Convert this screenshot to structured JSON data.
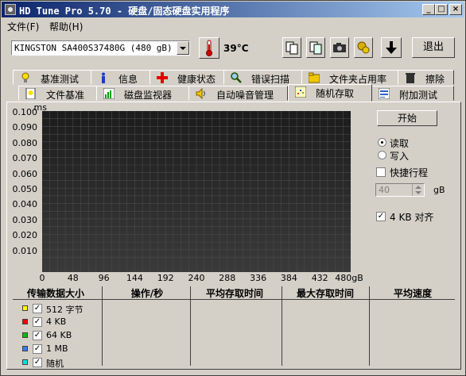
{
  "window": {
    "title": "HD Tune Pro 5.70 - 硬盘/固态硬盘实用程序",
    "controls": {
      "minimize": "_",
      "maximize": "□",
      "close": "×"
    }
  },
  "menu": {
    "file": "文件(F)",
    "help": "帮助(H)"
  },
  "toolbar": {
    "drive": "KINGSTON SA400S37480G (480 gB)",
    "temperature": "39°C",
    "exit_label": "退出"
  },
  "tabs_top": [
    {
      "label": "基准测试",
      "icon": "lightbulb-icon"
    },
    {
      "label": "信息",
      "icon": "info-icon"
    },
    {
      "label": "健康状态",
      "icon": "red-cross-icon"
    },
    {
      "label": "错误扫描",
      "icon": "magnifier-icon"
    },
    {
      "label": "文件夹占用率",
      "icon": "folder-icon"
    },
    {
      "label": "擦除",
      "icon": "trash-icon"
    }
  ],
  "tabs_bottom": [
    {
      "label": "文件基准",
      "icon": "file-bulb-icon"
    },
    {
      "label": "磁盘监视器",
      "icon": "monitor-chart-icon"
    },
    {
      "label": "自动噪音管理",
      "icon": "speaker-icon"
    },
    {
      "label": "随机存取",
      "icon": "random-access-icon",
      "active": true
    },
    {
      "label": "附加测试",
      "icon": "extra-tests-icon"
    }
  ],
  "chart_data": {
    "type": "scatter",
    "ylabel": "ms",
    "y_ticks": [
      "0.100",
      "0.090",
      "0.080",
      "0.070",
      "0.060",
      "0.050",
      "0.040",
      "0.030",
      "0.020",
      "0.010"
    ],
    "x_ticks": [
      "0",
      "48",
      "96",
      "144",
      "192",
      "240",
      "288",
      "336",
      "384",
      "432",
      "480gB"
    ],
    "ylim": [
      0,
      0.1
    ],
    "xlim": [
      0,
      480
    ],
    "grid": true,
    "series": []
  },
  "controls": {
    "start_label": "开始",
    "read_label": "读取",
    "write_label": "写入",
    "quick_label": "快捷行程",
    "quick_value": "40",
    "quick_unit": "gB",
    "align_label": "4 KB 对齐"
  },
  "table": {
    "headers": [
      "传输数据大小",
      "操作/秒",
      "平均存取时间",
      "最大存取时间",
      "平均速度"
    ],
    "rows": [
      {
        "label": "512 字节",
        "color": "#ffff00"
      },
      {
        "label": "4 KB",
        "color": "#ff0000"
      },
      {
        "label": "64 KB",
        "color": "#00c000"
      },
      {
        "label": "1 MB",
        "color": "#3c78ff"
      },
      {
        "label": "随机",
        "color": "#00e0e0"
      }
    ]
  }
}
